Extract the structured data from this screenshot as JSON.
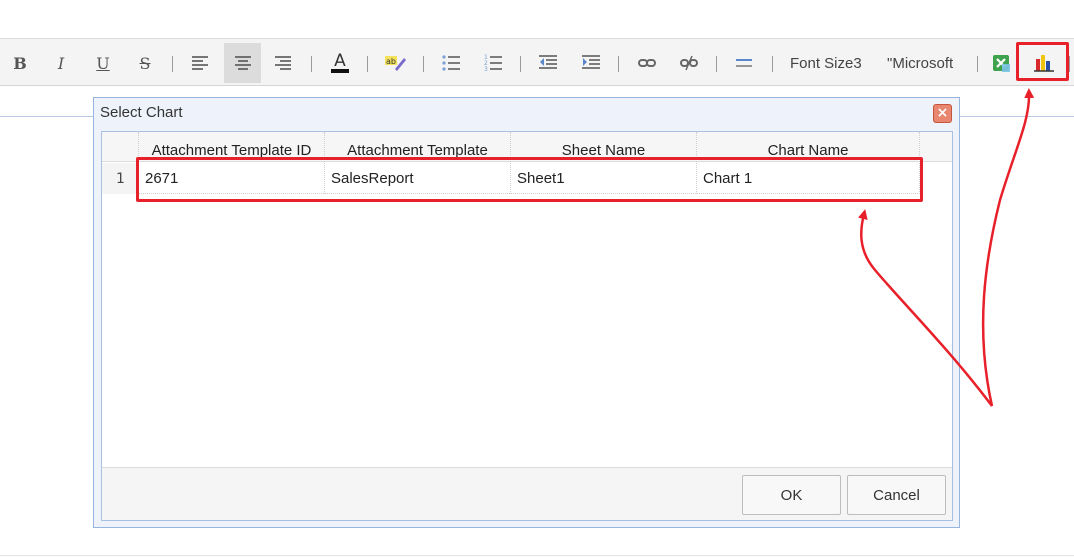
{
  "toolbar": {
    "bold": "B",
    "italic": "I",
    "underline": "U",
    "strike": "S",
    "font_color_letter": "A",
    "font_size_label": "Font Size3",
    "font_family_label": "\"Microsoft",
    "icons": [
      "bold-icon",
      "italic-icon",
      "underline-icon",
      "strikethrough-icon",
      "align-left-icon",
      "align-center-icon",
      "align-right-icon",
      "font-color-icon",
      "highlight-icon",
      "bulleted-list-icon",
      "numbered-list-icon",
      "outdent-icon",
      "indent-icon",
      "link-icon",
      "unlink-icon",
      "horizontal-rule-icon",
      "excel-icon",
      "chart-icon"
    ]
  },
  "dialog": {
    "title": "Select Chart",
    "close_symbol": "×",
    "columns": [
      "Attachment Template ID",
      "Attachment Template",
      "Sheet Name",
      "Chart Name"
    ],
    "rows": [
      {
        "num": "1",
        "id": "2671",
        "template": "SalesReport",
        "sheet": "Sheet1",
        "chart": "Chart 1"
      }
    ],
    "ok_label": "OK",
    "cancel_label": "Cancel"
  },
  "annotation": {
    "color": "#e8202a"
  }
}
